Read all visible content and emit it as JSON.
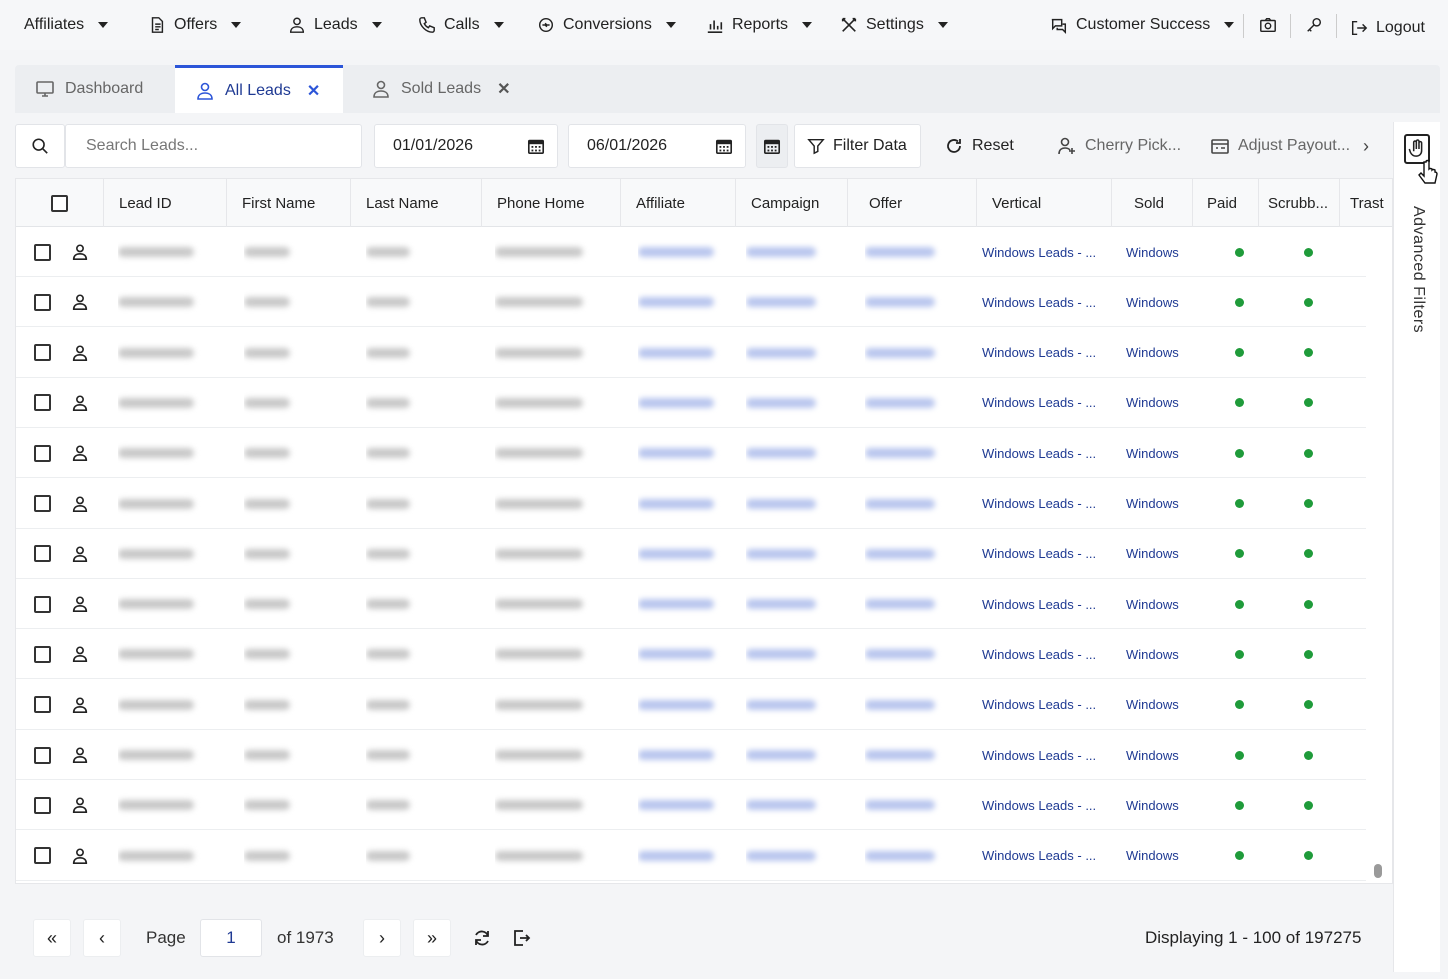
{
  "nav": {
    "items": [
      {
        "label": "Affiliates",
        "icon": "none"
      },
      {
        "label": "Offers",
        "icon": "document-icon"
      },
      {
        "label": "Leads",
        "icon": "user-icon"
      },
      {
        "label": "Calls",
        "icon": "phone-icon"
      },
      {
        "label": "Conversions",
        "icon": "conversions-icon"
      },
      {
        "label": "Reports",
        "icon": "chart-icon"
      },
      {
        "label": "Settings",
        "icon": "tools-icon"
      }
    ],
    "account": "Customer Success",
    "logout": "Logout"
  },
  "tabs": [
    {
      "label": "Dashboard",
      "active": false,
      "closable": false
    },
    {
      "label": "All Leads",
      "active": true,
      "closable": true
    },
    {
      "label": "Sold Leads",
      "active": false,
      "closable": true
    }
  ],
  "toolbar": {
    "search_placeholder": "Search Leads...",
    "date_from": "01/01/2026",
    "date_to": "06/01/2026",
    "filter_label": "Filter Data",
    "reset_label": "Reset",
    "cherry_pick_label": "Cherry Pick...",
    "adjust_payout_label": "Adjust Payout..."
  },
  "side_panel": {
    "label": "Advanced Filters"
  },
  "table": {
    "columns": [
      "Lead ID",
      "First Name",
      "Last Name",
      "Phone Home",
      "Affiliate",
      "Campaign",
      "Offer",
      "Vertical",
      "Sold",
      "Paid",
      "Scrubb...",
      "Trast"
    ],
    "rows": [
      {
        "vertical": "Windows Leads - ...",
        "sold": "Windows",
        "paid": true,
        "scrubbed": true
      },
      {
        "vertical": "Windows Leads - ...",
        "sold": "Windows",
        "paid": true,
        "scrubbed": true
      },
      {
        "vertical": "Windows Leads - ...",
        "sold": "Windows",
        "paid": true,
        "scrubbed": true
      },
      {
        "vertical": "Windows Leads - ...",
        "sold": "Windows",
        "paid": true,
        "scrubbed": true
      },
      {
        "vertical": "Windows Leads - ...",
        "sold": "Windows",
        "paid": true,
        "scrubbed": true
      },
      {
        "vertical": "Windows Leads - ...",
        "sold": "Windows",
        "paid": true,
        "scrubbed": true
      },
      {
        "vertical": "Windows Leads - ...",
        "sold": "Windows",
        "paid": true,
        "scrubbed": true
      },
      {
        "vertical": "Windows Leads - ...",
        "sold": "Windows",
        "paid": true,
        "scrubbed": true
      },
      {
        "vertical": "Windows Leads - ...",
        "sold": "Windows",
        "paid": true,
        "scrubbed": true
      },
      {
        "vertical": "Windows Leads - ...",
        "sold": "Windows",
        "paid": true,
        "scrubbed": true
      },
      {
        "vertical": "Windows Leads - ...",
        "sold": "Windows",
        "paid": true,
        "scrubbed": true
      },
      {
        "vertical": "Windows Leads - ...",
        "sold": "Windows",
        "paid": true,
        "scrubbed": true
      },
      {
        "vertical": "Windows Leads - ...",
        "sold": "Windows",
        "paid": true,
        "scrubbed": true
      }
    ]
  },
  "pagination": {
    "page_label": "Page",
    "current_page": "1",
    "of_label": "of 1973",
    "displaying": "Displaying 1 - 100 of 197275"
  },
  "colors": {
    "accent": "#2c55d8",
    "link": "#1f3a93",
    "status_green": "#1f9b3a"
  }
}
